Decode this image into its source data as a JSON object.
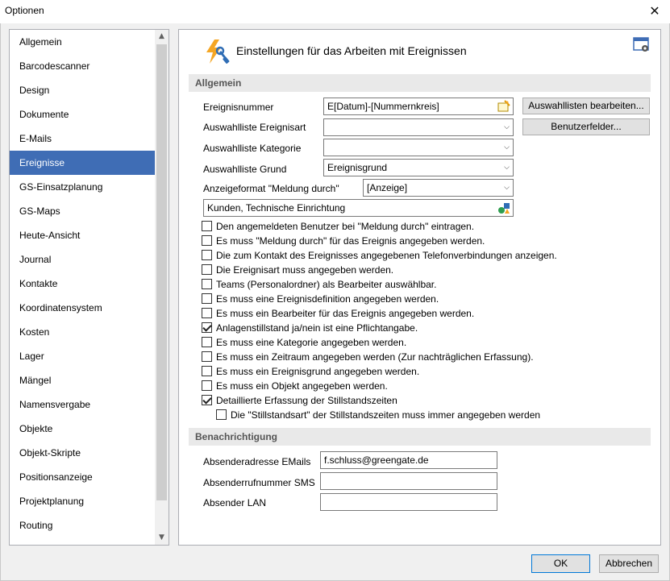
{
  "window": {
    "title": "Optionen",
    "close_glyph": "✕"
  },
  "sidebar": {
    "items": [
      {
        "label": "Allgemein"
      },
      {
        "label": "Barcodescanner"
      },
      {
        "label": "Design"
      },
      {
        "label": "Dokumente"
      },
      {
        "label": "E-Mails"
      },
      {
        "label": "Ereignisse",
        "active": true
      },
      {
        "label": "GS-Einsatzplanung"
      },
      {
        "label": "GS-Maps"
      },
      {
        "label": "Heute-Ansicht"
      },
      {
        "label": "Journal"
      },
      {
        "label": "Kontakte"
      },
      {
        "label": "Koordinatensystem"
      },
      {
        "label": "Kosten"
      },
      {
        "label": "Lager"
      },
      {
        "label": "Mängel"
      },
      {
        "label": "Namensvergabe"
      },
      {
        "label": "Objekte"
      },
      {
        "label": "Objekt-Skripte"
      },
      {
        "label": "Positionsanzeige"
      },
      {
        "label": "Projektplanung"
      },
      {
        "label": "Routing"
      }
    ],
    "scroll_up_glyph": "▲",
    "scroll_down_glyph": "▼"
  },
  "header": {
    "title": "Einstellungen für das Arbeiten mit Ereignissen",
    "icon": "lightning-wrench-icon",
    "settings_icon": "window-settings-icon"
  },
  "sections": {
    "allgemein": "Allgemein",
    "benachrichtigung": "Benachrichtigung"
  },
  "fields": {
    "ereignisnummer": {
      "label": "Ereignisnummer",
      "value": "E[Datum]-[Nummernkreis]"
    },
    "ereignisart": {
      "label": "Auswahlliste Ereignisart",
      "value": ""
    },
    "kategorie": {
      "label": "Auswahlliste Kategorie",
      "value": ""
    },
    "grund": {
      "label": "Auswahlliste Grund",
      "value": "Ereignisgrund"
    },
    "anzeigeformat": {
      "label": "Anzeigeformat \"Meldung durch\"",
      "value": "[Anzeige]"
    },
    "kontakte": {
      "value": "Kunden, Technische Einrichtung"
    }
  },
  "buttons": {
    "auswahllisten": "Auswahllisten bearbeiten...",
    "benutzerfelder": "Benutzerfelder...",
    "ok": "OK",
    "abbrechen": "Abbrechen"
  },
  "checkboxes": [
    {
      "label": "Den angemeldeten Benutzer bei \"Meldung durch\" eintragen.",
      "checked": false
    },
    {
      "label": "Es muss \"Meldung durch\" für das Ereignis angegeben werden.",
      "checked": false
    },
    {
      "label": "Die zum Kontakt des Ereignisses angegebenen Telefonverbindungen anzeigen.",
      "checked": false
    },
    {
      "label": "Die Ereignisart muss angegeben werden.",
      "checked": false
    },
    {
      "label": "Teams (Personalordner) als Bearbeiter auswählbar.",
      "checked": false
    },
    {
      "label": "Es muss eine Ereignisdefinition angegeben werden.",
      "checked": false
    },
    {
      "label": "Es muss ein Bearbeiter für das Ereignis angegeben werden.",
      "checked": false
    },
    {
      "label": "Anlagenstillstand ja/nein ist eine Pflichtangabe.",
      "checked": true
    },
    {
      "label": "Es muss eine Kategorie angegeben werden.",
      "checked": false
    },
    {
      "label": "Es muss ein Zeitraum angegeben werden (Zur nachträglichen Erfassung).",
      "checked": false
    },
    {
      "label": "Es muss ein Ereignisgrund angegeben werden.",
      "checked": false
    },
    {
      "label": "Es muss ein Objekt angegeben werden.",
      "checked": false
    },
    {
      "label": "Detaillierte Erfassung der Stillstandszeiten",
      "checked": true
    },
    {
      "label": "Die \"Stillstandsart\" der Stillstandszeiten muss immer angegeben werden",
      "checked": false,
      "indent": true
    }
  ],
  "notification": {
    "email": {
      "label": "Absenderadresse EMails",
      "value": "f.schluss@greengate.de"
    },
    "sms": {
      "label": "Absenderrufnummer SMS",
      "value": ""
    },
    "lan": {
      "label": "Absender LAN",
      "value": ""
    }
  },
  "combo_arrow_glyph": "⌵"
}
